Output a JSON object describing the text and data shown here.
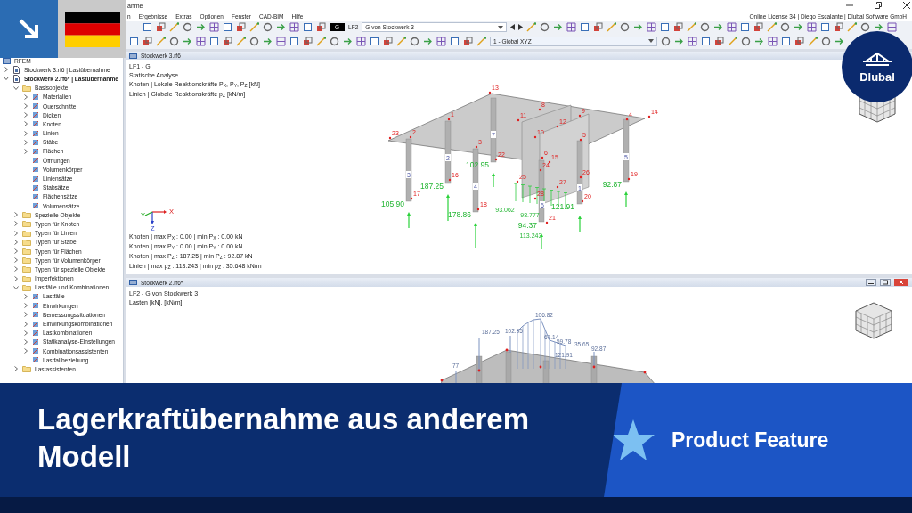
{
  "window": {
    "title": "ahme",
    "menu": [
      "n",
      "Ergebnisse",
      "Extras",
      "Optionen",
      "Fenster",
      "CAD-BIM",
      "Hilfe"
    ],
    "license": "Online License 34 | Diego Escalante | Dlubal Software GmbH"
  },
  "toolbar": {
    "load_case_tag": "G",
    "load_case": "LF2",
    "load_case_name": "G von Stockwerk 3",
    "coordinate_system": "1 - Global XYZ"
  },
  "navigator": {
    "root": "RFEM",
    "items": [
      {
        "label": "Stockwerk 3.rf6 | Lastübernahme",
        "kind": "model",
        "active": false,
        "expanded": false
      },
      {
        "label": "Stockwerk 2.rf6* | Lastübernahme",
        "kind": "model",
        "active": true,
        "expanded": true,
        "children": [
          {
            "label": "Basisobjekte",
            "kind": "folder",
            "expanded": true,
            "children": [
              {
                "label": "Materialien",
                "kind": "object",
                "expanded": false
              },
              {
                "label": "Querschnitte",
                "kind": "object",
                "expanded": false
              },
              {
                "label": "Dicken",
                "kind": "object",
                "expanded": false
              },
              {
                "label": "Knoten",
                "kind": "object",
                "expanded": false
              },
              {
                "label": "Linien",
                "kind": "object",
                "expanded": false
              },
              {
                "label": "Stäbe",
                "kind": "object",
                "expanded": false
              },
              {
                "label": "Flächen",
                "kind": "object",
                "expanded": false
              },
              {
                "label": "Öffnungen",
                "kind": "object"
              },
              {
                "label": "Volumenkörper",
                "kind": "object"
              },
              {
                "label": "Liniensätze",
                "kind": "object"
              },
              {
                "label": "Stabsätze",
                "kind": "object"
              },
              {
                "label": "Flächensätze",
                "kind": "object"
              },
              {
                "label": "Volumensätze",
                "kind": "object"
              }
            ]
          },
          {
            "label": "Spezielle Objekte",
            "kind": "folder",
            "expanded": false
          },
          {
            "label": "Typen für Knoten",
            "kind": "folder",
            "expanded": false
          },
          {
            "label": "Typen für Linien",
            "kind": "folder",
            "expanded": false
          },
          {
            "label": "Typen für Stäbe",
            "kind": "folder",
            "expanded": false
          },
          {
            "label": "Typen für Flächen",
            "kind": "folder",
            "expanded": false
          },
          {
            "label": "Typen für Volumenkörper",
            "kind": "folder",
            "expanded": false
          },
          {
            "label": "Typen für spezielle Objekte",
            "kind": "folder",
            "expanded": false
          },
          {
            "label": "Imperfektionen",
            "kind": "folder",
            "expanded": false
          },
          {
            "label": "Lastfälle und Kombinationen",
            "kind": "folder",
            "expanded": true,
            "children": [
              {
                "label": "Lastfälle",
                "kind": "object",
                "expanded": false
              },
              {
                "label": "Einwirkungen",
                "kind": "object",
                "expanded": false
              },
              {
                "label": "Bemessungssituationen",
                "kind": "object",
                "expanded": false
              },
              {
                "label": "Einwirkungskombinationen",
                "kind": "object",
                "expanded": false
              },
              {
                "label": "Lastkombinationen",
                "kind": "object",
                "expanded": false
              },
              {
                "label": "Statikanalyse-Einstellungen",
                "kind": "object",
                "expanded": false
              },
              {
                "label": "Kombinationsassistenten",
                "kind": "object",
                "expanded": false
              },
              {
                "label": "Lastfallbeziehung",
                "kind": "object"
              }
            ]
          },
          {
            "label": "Lastassistenten",
            "kind": "folder",
            "expanded": false
          }
        ]
      }
    ]
  },
  "views": [
    {
      "kind": "results",
      "title": "Stockwerk 3.rf6",
      "info": [
        "LF1 - G",
        "Statische Analyse",
        "Knoten | Lokale Reaktionskräfte P$_{X}$, P$_{Y}$, P$_{Z}$ [kN]",
        "Linien | Globale Reaktionskräfte p$_{Z}$ [kN/m]"
      ],
      "summary": [
        "Knoten | max P$_{X}$ : 0.00 | min P$_{X}$ : 0.00 kN",
        "Knoten | max P$_{Y}$ : 0.00 | min P$_{Y}$ : 0.00 kN",
        "Knoten | max P$_{Z}$ : 187.25 | min P$_{Z}$ : 92.87 kN",
        "Linien | max p$_{Z}$ : 113.243 | min p$_{Z}$ : 35.648 kN/m"
      ],
      "axis_labels": [
        "X",
        "Y",
        "Z"
      ],
      "reactions": [
        "102.95",
        "187.25",
        "92.87",
        "105.90",
        "121.91",
        "178.86",
        "94.37"
      ],
      "line_values": [
        "93.062",
        "98.777",
        "113.243"
      ],
      "nodes": [
        "13",
        "8",
        "1",
        "11",
        "9",
        "4",
        "14",
        "12",
        "23",
        "2",
        "10",
        "5",
        "3",
        "22",
        "6",
        "15",
        "24",
        "16",
        "25",
        "26",
        "19",
        "27",
        "17",
        "28",
        "20",
        "18",
        "21"
      ],
      "members": [
        "7",
        "2",
        "5",
        "3",
        "4",
        "1",
        "6"
      ]
    },
    {
      "kind": "loads",
      "title": "Stockwerk 2.rf6*",
      "info": [
        "LF2 - G von Stockwerk 3",
        "Lasten [kN], [kN/m]"
      ],
      "loads": [
        "106.82",
        "187.25",
        "102.95",
        "67.14",
        "59.78",
        "35.65",
        "92.87",
        "121.91",
        "77"
      ]
    }
  ],
  "logo": {
    "name": "Dlubal"
  },
  "banner": {
    "heading": "Lagerkraftübernahme aus anderem Modell",
    "tag": "Product Feature"
  }
}
